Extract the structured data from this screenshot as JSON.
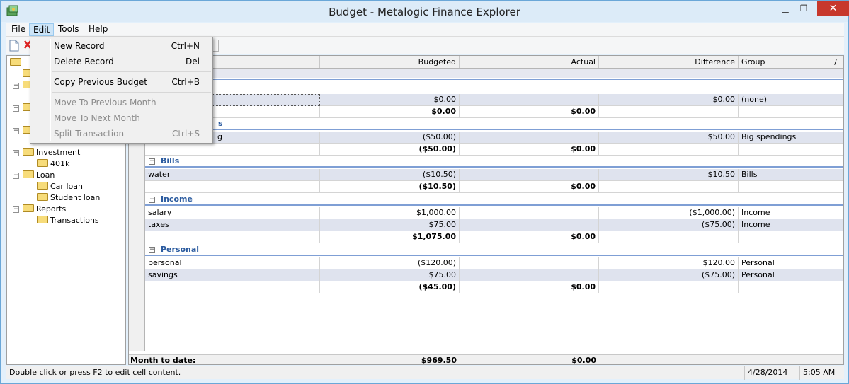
{
  "window": {
    "title": "Budget - Metalogic Finance Explorer",
    "min": "▁",
    "max": "❐",
    "close": "✕"
  },
  "menubar": [
    "File",
    "Edit",
    "Tools",
    "Help"
  ],
  "edit_menu": [
    {
      "label": "New Record",
      "shortcut": "Ctrl+N",
      "enabled": true
    },
    {
      "label": "Delete Record",
      "shortcut": "Del",
      "enabled": true
    },
    {
      "label": "Copy Previous Budget",
      "shortcut": "Ctrl+B",
      "enabled": true
    },
    {
      "label": "Move To Previous Month",
      "shortcut": "",
      "enabled": false
    },
    {
      "label": "Move To Next Month",
      "shortcut": "",
      "enabled": false
    },
    {
      "label": "Split Transaction",
      "shortcut": "Ctrl+S",
      "enabled": false
    }
  ],
  "tree": {
    "investment": "Investment",
    "k401": "401k",
    "loan": "Loan",
    "car_loan": "Car loan",
    "student_loan": "Student loan",
    "reports": "Reports",
    "transactions": "Transactions"
  },
  "grid": {
    "headers": {
      "budgeted": "Budgeted",
      "actual": "Actual",
      "difference": "Difference",
      "group": "Group",
      "sort": "/"
    },
    "row1": {
      "budgeted": "$0.00",
      "difference": "$0.00",
      "group": "(none)"
    },
    "row1_total": {
      "budgeted": "$0.00",
      "actual": "$0.00"
    },
    "grp2_tail": "s",
    "row2": {
      "cat_tail": "g",
      "budgeted": "($50.00)",
      "difference": "$50.00",
      "group": "Big spendings"
    },
    "row2_total": {
      "budgeted": "($50.00)",
      "actual": "$0.00"
    },
    "bills": {
      "label": "Bills",
      "rows": [
        {
          "cat": "water",
          "budgeted": "($10.50)",
          "difference": "$10.50",
          "group": "Bills"
        }
      ],
      "total": {
        "budgeted": "($10.50)",
        "actual": "$0.00"
      }
    },
    "income": {
      "label": "Income",
      "rows": [
        {
          "cat": "salary",
          "budgeted": "$1,000.00",
          "difference": "($1,000.00)",
          "group": "Income"
        },
        {
          "cat": "taxes",
          "budgeted": "$75.00",
          "difference": "($75.00)",
          "group": "Income"
        }
      ],
      "total": {
        "budgeted": "$1,075.00",
        "actual": "$0.00"
      }
    },
    "personal": {
      "label": "Personal",
      "rows": [
        {
          "cat": "personal",
          "budgeted": "($120.00)",
          "difference": "$120.00",
          "group": "Personal"
        },
        {
          "cat": "savings",
          "budgeted": "$75.00",
          "difference": "($75.00)",
          "group": "Personal"
        }
      ],
      "total": {
        "budgeted": "($45.00)",
        "actual": "$0.00"
      }
    },
    "month_to_date": {
      "label": "Month to date:",
      "budgeted": "$969.50",
      "actual": "$0.00"
    }
  },
  "status": {
    "hint": "Double click or press F2 to edit cell content.",
    "date": "4/28/2014",
    "time": "5:05 AM"
  },
  "collapse_glyph": "−"
}
